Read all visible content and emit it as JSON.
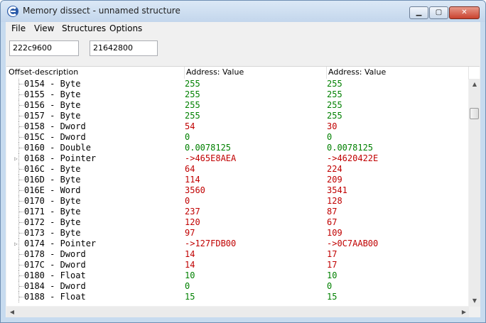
{
  "window": {
    "title": "Memory dissect - unnamed structure"
  },
  "titlebar_buttons": {
    "minimize": "▁",
    "maximize": "▢",
    "close": "✕"
  },
  "menu": [
    "File",
    "View",
    "Structures",
    "Options"
  ],
  "addresses": [
    "222c9600",
    "21642800"
  ],
  "columns": [
    "Offset-description",
    "Address: Value",
    "Address: Value"
  ],
  "rows": [
    {
      "desc": "0154 - Byte",
      "expandable": false,
      "v1": "255",
      "v2": "255",
      "color": "green"
    },
    {
      "desc": "0155 - Byte",
      "expandable": false,
      "v1": "255",
      "v2": "255",
      "color": "green"
    },
    {
      "desc": "0156 - Byte",
      "expandable": false,
      "v1": "255",
      "v2": "255",
      "color": "green"
    },
    {
      "desc": "0157 - Byte",
      "expandable": false,
      "v1": "255",
      "v2": "255",
      "color": "green"
    },
    {
      "desc": "0158 - Dword",
      "expandable": false,
      "v1": "54",
      "v2": "30",
      "color": "red"
    },
    {
      "desc": "015C - Dword",
      "expandable": false,
      "v1": "0",
      "v2": "0",
      "color": "green"
    },
    {
      "desc": "0160 - Double",
      "expandable": false,
      "v1": "0.0078125",
      "v2": "0.0078125",
      "color": "green"
    },
    {
      "desc": "0168 - Pointer",
      "expandable": true,
      "v1": "->465E8AEA",
      "v2": "->4620422E",
      "color": "red"
    },
    {
      "desc": "016C - Byte",
      "expandable": false,
      "v1": "64",
      "v2": "224",
      "color": "red"
    },
    {
      "desc": "016D - Byte",
      "expandable": false,
      "v1": "114",
      "v2": "209",
      "color": "red"
    },
    {
      "desc": "016E - Word",
      "expandable": false,
      "v1": "3560",
      "v2": "3541",
      "color": "red"
    },
    {
      "desc": "0170 - Byte",
      "expandable": false,
      "v1": "0",
      "v2": "128",
      "color": "red"
    },
    {
      "desc": "0171 - Byte",
      "expandable": false,
      "v1": "237",
      "v2": "87",
      "color": "red"
    },
    {
      "desc": "0172 - Byte",
      "expandable": false,
      "v1": "120",
      "v2": "67",
      "color": "red"
    },
    {
      "desc": "0173 - Byte",
      "expandable": false,
      "v1": "97",
      "v2": "109",
      "color": "red"
    },
    {
      "desc": "0174 - Pointer",
      "expandable": true,
      "v1": "->127FDB00",
      "v2": "->0C7AAB00",
      "color": "red"
    },
    {
      "desc": "0178 - Dword",
      "expandable": false,
      "v1": "14",
      "v2": "17",
      "color": "red"
    },
    {
      "desc": "017C - Dword",
      "expandable": false,
      "v1": "14",
      "v2": "17",
      "color": "red"
    },
    {
      "desc": "0180 - Float",
      "expandable": false,
      "v1": "10",
      "v2": "10",
      "color": "green"
    },
    {
      "desc": "0184 - Dword",
      "expandable": false,
      "v1": "0",
      "v2": "0",
      "color": "green"
    },
    {
      "desc": "0188 - Float",
      "expandable": false,
      "v1": "15",
      "v2": "15",
      "color": "green"
    }
  ],
  "scroll": {
    "up": "▲",
    "down": "▼",
    "left": "◀",
    "right": "▶",
    "expander": "▷"
  }
}
